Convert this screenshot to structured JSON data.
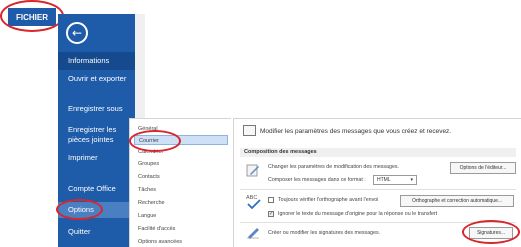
{
  "file_tab": {
    "label": "FICHIER"
  },
  "backstage": {
    "back_icon": "back-arrow-icon",
    "items": [
      {
        "label": "Informations"
      },
      {
        "label": "Ouvrir et exporter"
      },
      {
        "label": "Enregistrer sous"
      },
      {
        "label": "Enregistrer les pièces jointes"
      },
      {
        "label": "Imprimer"
      },
      {
        "label": "Compte Office"
      },
      {
        "label": "Options"
      },
      {
        "label": "Quitter"
      }
    ]
  },
  "categories": [
    {
      "label": "Général"
    },
    {
      "label": "Courrier"
    },
    {
      "label": "Calendrier"
    },
    {
      "label": "Groupes"
    },
    {
      "label": "Contacts"
    },
    {
      "label": "Tâches"
    },
    {
      "label": "Recherche"
    },
    {
      "label": "Langue"
    },
    {
      "label": "Facilité d'accès"
    },
    {
      "label": "Options avancées"
    }
  ],
  "mail_options": {
    "header": "Modifier les paramètres des messages que vous créez et recevez.",
    "compose_section": "Composition des messages",
    "change_settings_text": "Changer les paramètres de modification des messages.",
    "editor_options_button": "Options de l'éditeur...",
    "compose_format_label": "Composer les messages dans ce format :",
    "compose_format_value": "HTML",
    "spellcheck_label": "Toujours vérifier l'orthographe avant l'envoi",
    "spellcheck_checked": false,
    "spell_grammar_button": "Orthographe et correction automatique...",
    "ignore_original_label": "Ignorer le texte du message d'origine pour la réponse ou le transfert",
    "ignore_original_checked": true,
    "signatures_text": "Créer ou modifier les signatures des messages.",
    "signatures_button": "Signatures..."
  },
  "colors": {
    "backstage_blue": "#1e5ba8",
    "highlight_red": "#d8262a",
    "selected_category": "#cde0f5"
  }
}
